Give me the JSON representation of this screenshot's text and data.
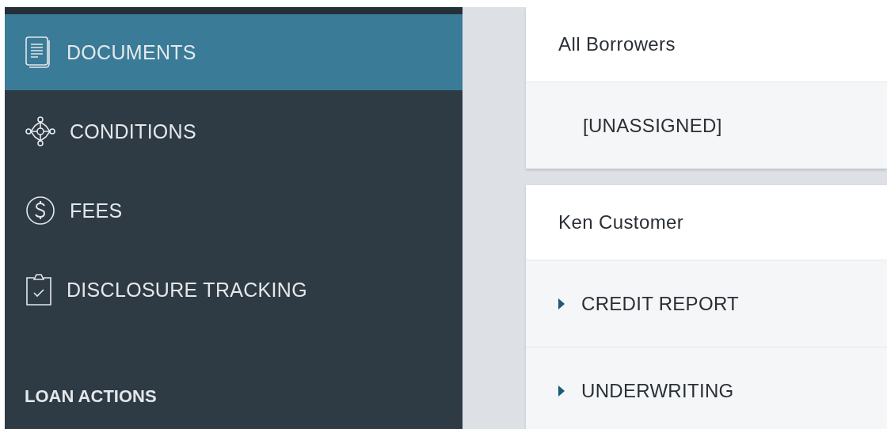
{
  "sidebar": {
    "items": [
      {
        "label": "DOCUMENTS",
        "kind": "documents",
        "selected": true
      },
      {
        "label": "CONDITIONS",
        "kind": "conditions",
        "selected": false
      },
      {
        "label": "FEES",
        "kind": "fees",
        "selected": false
      },
      {
        "label": "DISCLOSURE TRACKING",
        "kind": "disclosures",
        "selected": false
      }
    ],
    "section_heading": "LOAN ACTIONS"
  },
  "groups": [
    {
      "title": "All Borrowers",
      "rows": [
        {
          "label": "[UNASSIGNED]",
          "kind": "plain"
        }
      ]
    },
    {
      "title": "Ken Customer",
      "rows": [
        {
          "label": "CREDIT REPORT",
          "kind": "folder",
          "expanded": false
        },
        {
          "label": "UNDERWRITING",
          "kind": "folder",
          "expanded": false
        }
      ]
    }
  ]
}
